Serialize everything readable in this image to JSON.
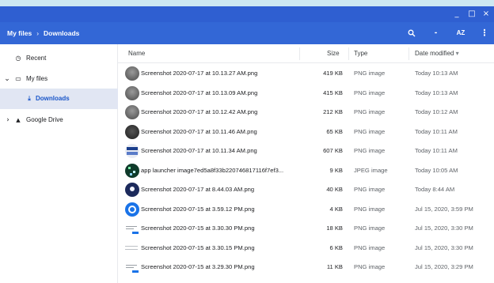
{
  "window": {
    "minimize_glyph": "_",
    "maximize_glyph": "□",
    "close_glyph": "×"
  },
  "breadcrumb": {
    "root": "My files",
    "separator": "›",
    "current": "Downloads"
  },
  "toolbar": {
    "search_icon": "search-icon",
    "grid_glyph": "▪▪▪",
    "sort_glyph": "AZ",
    "more_glyph": "⋮"
  },
  "sidebar": {
    "items": [
      {
        "label": "Recent",
        "icon": "clock-icon",
        "glyph": "◷",
        "expander": ""
      },
      {
        "label": "My files",
        "icon": "laptop-icon",
        "glyph": "▭",
        "expander": "⌄"
      },
      {
        "label": "Downloads",
        "icon": "download-icon",
        "glyph": "⤓",
        "expander": ""
      },
      {
        "label": "Google Drive",
        "icon": "drive-icon",
        "glyph": "▲",
        "expander": "›"
      }
    ]
  },
  "columns": {
    "name": "Name",
    "size": "Size",
    "type": "Type",
    "date": "Date modified",
    "sort_indicator": "▾"
  },
  "files": [
    {
      "name": "Screenshot 2020-07-17 at 10.13.27 AM.png",
      "size": "419 KB",
      "type": "PNG image",
      "modified": "Today 10:13 AM",
      "thumb": "gray"
    },
    {
      "name": "Screenshot 2020-07-17 at 10.13.09 AM.png",
      "size": "415 KB",
      "type": "PNG image",
      "modified": "Today 10:13 AM",
      "thumb": "gray"
    },
    {
      "name": "Screenshot 2020-07-17 at 10.12.42 AM.png",
      "size": "212 KB",
      "type": "PNG image",
      "modified": "Today 10:12 AM",
      "thumb": "gray"
    },
    {
      "name": "Screenshot 2020-07-17 at 10.11.46 AM.png",
      "size": "65 KB",
      "type": "PNG image",
      "modified": "Today 10:11 AM",
      "thumb": "dark"
    },
    {
      "name": "Screenshot 2020-07-17 at 10.11.34 AM.png",
      "size": "607 KB",
      "type": "PNG image",
      "modified": "Today 10:11 AM",
      "thumb": "screen"
    },
    {
      "name": "app launcher image7ed5a8f33b220746817116f7ef3...",
      "size": "9 KB",
      "type": "JPEG image",
      "modified": "Today 10:05 AM",
      "thumb": "green"
    },
    {
      "name": "Screenshot 2020-07-17 at 8.44.03 AM.png",
      "size": "40 KB",
      "type": "PNG image",
      "modified": "Today 8:44 AM",
      "thumb": "navy"
    },
    {
      "name": "Screenshot 2020-07-15 at 3.59.12 PM.png",
      "size": "4 KB",
      "type": "PNG image",
      "modified": "Jul 15, 2020, 3:59 PM",
      "thumb": "blue"
    },
    {
      "name": "Screenshot 2020-07-15 at 3.30.30 PM.png",
      "size": "18 KB",
      "type": "PNG image",
      "modified": "Jul 15, 2020, 3:30 PM",
      "thumb": "doc"
    },
    {
      "name": "Screenshot 2020-07-15 at 3.30.15 PM.png",
      "size": "6 KB",
      "type": "PNG image",
      "modified": "Jul 15, 2020, 3:30 PM",
      "thumb": "text"
    },
    {
      "name": "Screenshot 2020-07-15 at 3.29.30 PM.png",
      "size": "11 KB",
      "type": "PNG image",
      "modified": "Jul 15, 2020, 3:29 PM",
      "thumb": "doc"
    }
  ],
  "colors": {
    "titlebar": "#2f5fd1",
    "toolbar": "#3367d6",
    "selected_bg": "#e1e6f3",
    "selected_text": "#1a56c9"
  }
}
